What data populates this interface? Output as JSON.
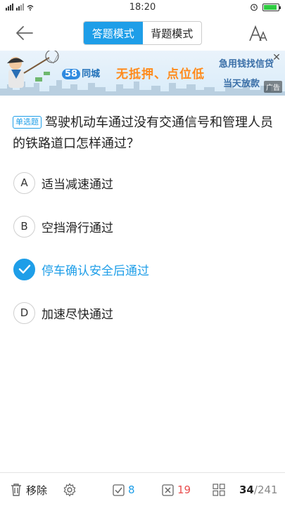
{
  "status_bar": {
    "signal_text": "5ill 5ill",
    "time": "18:20"
  },
  "nav": {
    "back_icon": "back-arrow-icon",
    "modes": [
      {
        "label": "答题模式",
        "active": true
      },
      {
        "label": "背题模式",
        "active": false
      }
    ],
    "font_icon": "font-size-icon"
  },
  "ad": {
    "logo_text": "同城",
    "logo_num": "58",
    "headline": "无抵押、点位低",
    "line1": "急用钱找信贷",
    "line2": "当天放款",
    "tag": "广告",
    "close": "✕"
  },
  "question": {
    "type_badge": "单选题",
    "text": "驾驶机动车通过没有交通信号和管理人员的铁路道口怎样通过？"
  },
  "options": [
    {
      "letter": "A",
      "text": "适当减速通过",
      "selected": false
    },
    {
      "letter": "B",
      "text": "空挡滑行通过",
      "selected": false
    },
    {
      "letter": "C",
      "text": "停车确认安全后通过",
      "selected": true
    },
    {
      "letter": "D",
      "text": "加速尽快通过",
      "selected": false
    }
  ],
  "bottom_bar": {
    "remove_label": "移除",
    "correct_count": "8",
    "wrong_count": "19",
    "current": "34",
    "separator": "/",
    "total": "241"
  },
  "colors": {
    "accent": "#1e9ee8",
    "wrong": "#e94e4e",
    "ad_orange": "#ff8a1a"
  }
}
